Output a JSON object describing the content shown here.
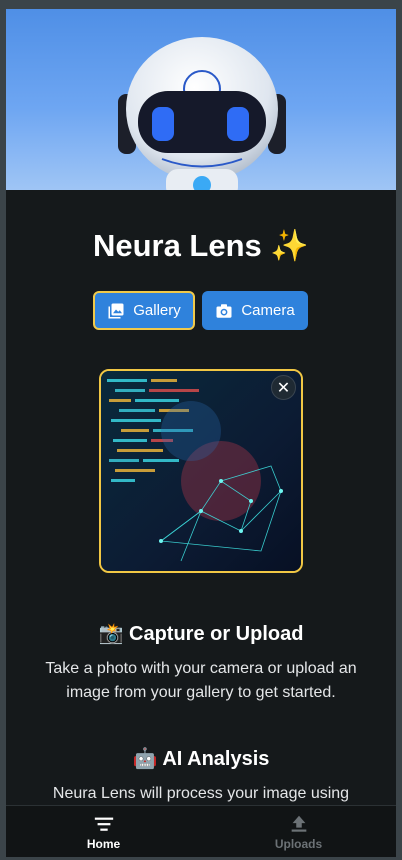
{
  "header": {
    "title": "Neura Lens",
    "title_emoji": "✨"
  },
  "actions": {
    "gallery_label": "Gallery",
    "camera_label": "Camera"
  },
  "preview": {
    "close_symbol": "✕"
  },
  "sections": [
    {
      "emoji": "📸",
      "title": "Capture or Upload",
      "text": "Take a photo with your camera or upload an image from your gallery to get started."
    },
    {
      "emoji": "🤖",
      "title": "AI Analysis",
      "text": "Neura Lens will process your image using"
    }
  ],
  "nav": {
    "home_label": "Home",
    "uploads_label": "Uploads"
  },
  "colors": {
    "accent": "#2f82dc",
    "highlight": "#f1c744",
    "background": "#15191b"
  },
  "icons": {
    "gallery": "image-gallery-icon",
    "camera": "camera-icon",
    "close": "close-icon",
    "home": "menu-lines-icon",
    "uploads": "upload-icon"
  }
}
